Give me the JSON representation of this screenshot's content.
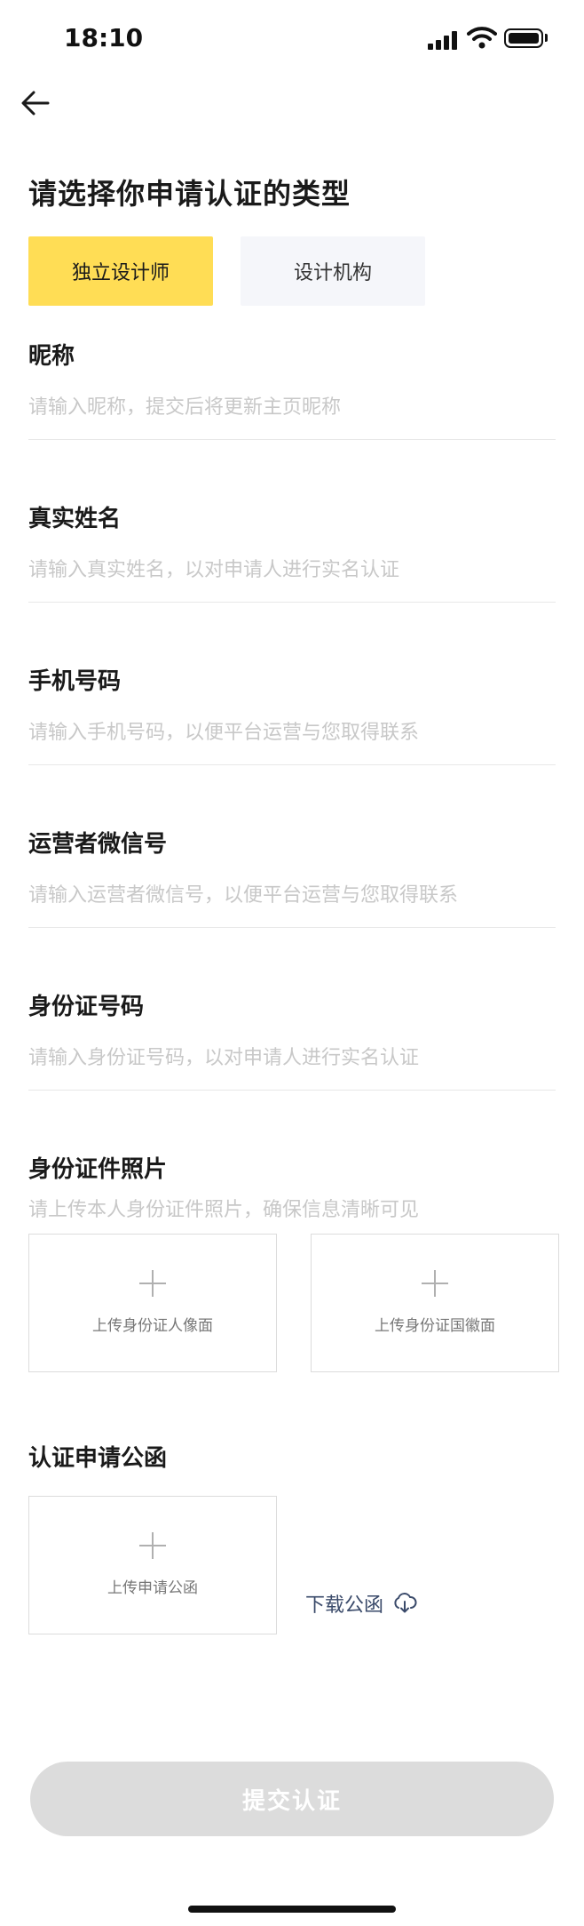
{
  "status_bar": {
    "time": "18:10"
  },
  "page": {
    "title": "请选择你申请认证的类型"
  },
  "type_options": [
    {
      "label": "独立设计师",
      "selected": true
    },
    {
      "label": "设计机构",
      "selected": false
    }
  ],
  "fields": {
    "nickname": {
      "label": "昵称",
      "placeholder": "请输入昵称，提交后将更新主页昵称",
      "value": ""
    },
    "real_name": {
      "label": "真实姓名",
      "placeholder": "请输入真实姓名，以对申请人进行实名认证",
      "value": ""
    },
    "phone": {
      "label": "手机号码",
      "placeholder": "请输入手机号码，以便平台运营与您取得联系",
      "value": ""
    },
    "wechat": {
      "label": "运营者微信号",
      "placeholder": "请输入运营者微信号，以便平台运营与您取得联系",
      "value": ""
    },
    "id_number": {
      "label": "身份证号码",
      "placeholder": "请输入身份证号码，以对申请人进行实名认证",
      "value": ""
    }
  },
  "id_photo": {
    "label": "身份证件照片",
    "hint": "请上传本人身份证件照片，确保信息清晰可见",
    "uploads": [
      "上传身份证人像面",
      "上传身份证国徽面"
    ]
  },
  "letter": {
    "label": "认证申请公函",
    "upload_label": "上传申请公函",
    "download_label": "下载公函"
  },
  "submit_label": "提交认证",
  "colors": {
    "accent": "#FFDD55",
    "inactive_bg": "#F5F6FA",
    "disabled_button": "#DCDCDC"
  }
}
